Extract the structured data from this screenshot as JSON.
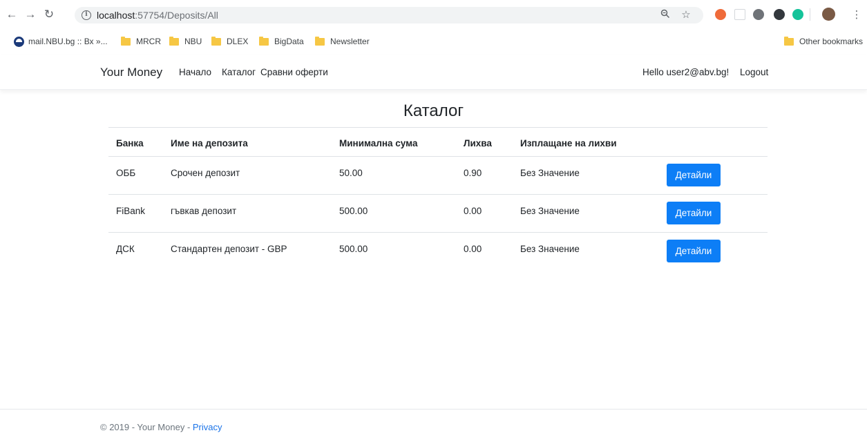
{
  "browser": {
    "url_host": "localhost",
    "url_rest": ":57754/Deposits/All",
    "bookmarks": [
      "mail.NBU.bg :: Вх »...",
      "MRCR",
      "NBU",
      "DLEX",
      "BigData",
      "Newsletter"
    ],
    "other_bookmarks": "Other bookmarks"
  },
  "navbar": {
    "brand": "Your Money",
    "links": [
      "Начало",
      "Каталог",
      "Сравни оферти"
    ],
    "greeting": "Hello user2@abv.bg!",
    "logout": "Logout"
  },
  "main": {
    "title": "Каталог",
    "columns": [
      "Банка",
      "Име на депозита",
      "Минимална сума",
      "Лихва",
      "Изплащане на лихви"
    ],
    "rows": [
      {
        "bank": "ОББ",
        "name": "Срочен депозит",
        "min_amount": "50.00",
        "interest": "0.90",
        "payout": "Без Значение",
        "action": "Детайли"
      },
      {
        "bank": "FiBank",
        "name": "гъвкав депозит",
        "min_amount": "500.00",
        "interest": "0.00",
        "payout": "Без Значение",
        "action": "Детайли"
      },
      {
        "bank": "ДСК",
        "name": "Стандартен депозит - GBP",
        "min_amount": "500.00",
        "interest": "0.00",
        "payout": "Без Значение",
        "action": "Детайли"
      }
    ]
  },
  "footer": {
    "text": "© 2019 - Your Money - ",
    "privacy": "Privacy"
  },
  "colors": {
    "primary_button": "#0d7ef6",
    "link": "#1a73e8"
  }
}
